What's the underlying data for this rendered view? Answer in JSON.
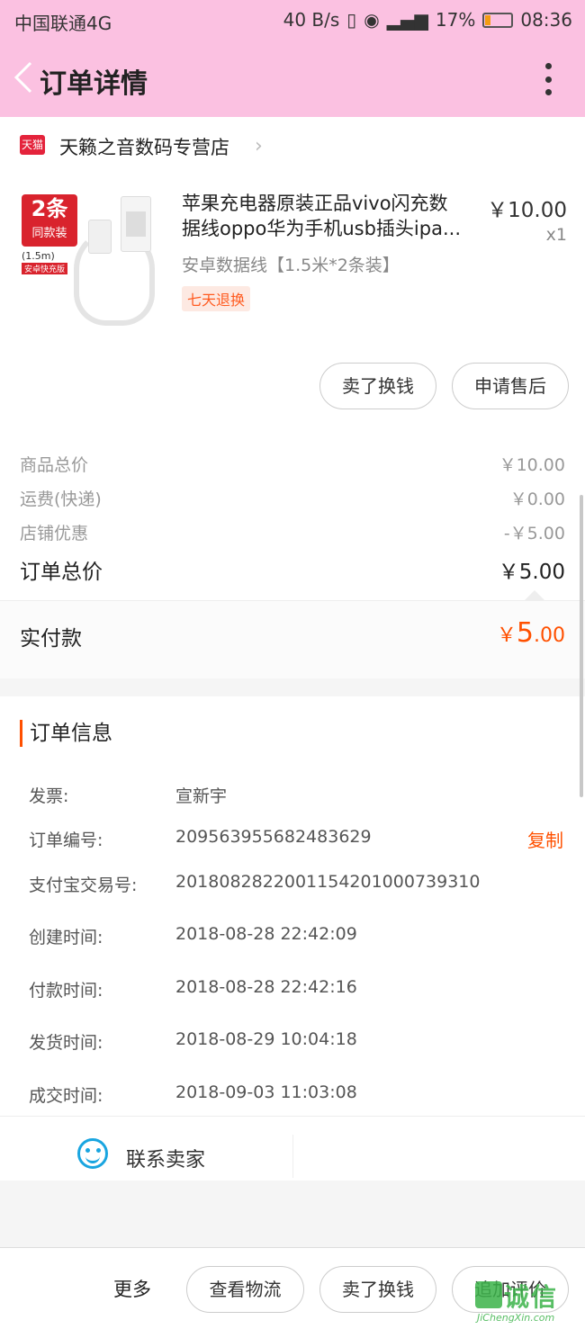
{
  "status_bar": {
    "carrier": "中国联通4G",
    "speed": "40 B/s",
    "battery": "17%",
    "time": "08:36"
  },
  "header": {
    "title": "订单详情"
  },
  "shop": {
    "logo": "天猫",
    "name": "天籁之音数码专营店"
  },
  "product": {
    "thumb_badge": "2条",
    "thumb_badge_sub": "同款装",
    "thumb_length": "(1.5m)",
    "thumb_tag": "安卓快充版",
    "title_line1": "苹果充电器原装正品vivo闪充数",
    "title_line2": "据线oppo华为手机usb插头ipa...",
    "price": "￥10.00",
    "qty": "x1",
    "sku": "安卓数据线【1.5米*2条装】",
    "tag": "七天退换",
    "buttons": {
      "sell": "卖了换钱",
      "after_sale": "申请售后"
    }
  },
  "summary": {
    "goods_total_label": "商品总价",
    "goods_total": "￥10.00",
    "shipping_label": "运费(快递)",
    "shipping": "￥0.00",
    "discount_label": "店铺优惠",
    "discount": "-￥5.00",
    "order_total_label": "订单总价",
    "order_total": "￥5.00",
    "paid_label": "实付款",
    "paid_currency": "￥",
    "paid_int": "5",
    "paid_dec": ".00"
  },
  "order_info": {
    "heading": "订单信息",
    "rows": [
      {
        "label": "发票:",
        "value": "宣新宇"
      },
      {
        "label": "订单编号:",
        "value": "209563955682483629"
      },
      {
        "label": "支付宝交易号:",
        "value": "2018082822001154201000739310"
      },
      {
        "label": "创建时间:",
        "value": "2018-08-28 22:42:09"
      },
      {
        "label": "付款时间:",
        "value": "2018-08-28 22:42:16"
      },
      {
        "label": "发货时间:",
        "value": "2018-08-29 10:04:18"
      },
      {
        "label": "成交时间:",
        "value": "2018-09-03 11:03:08"
      }
    ],
    "copy": "复制"
  },
  "contact": {
    "label": "联系卖家"
  },
  "bottom_bar": {
    "more": "更多",
    "logistics": "查看物流",
    "sell": "卖了换钱",
    "review": "追加评价"
  },
  "watermark": {
    "text": "诚信",
    "url": "JiChengXin.com"
  }
}
